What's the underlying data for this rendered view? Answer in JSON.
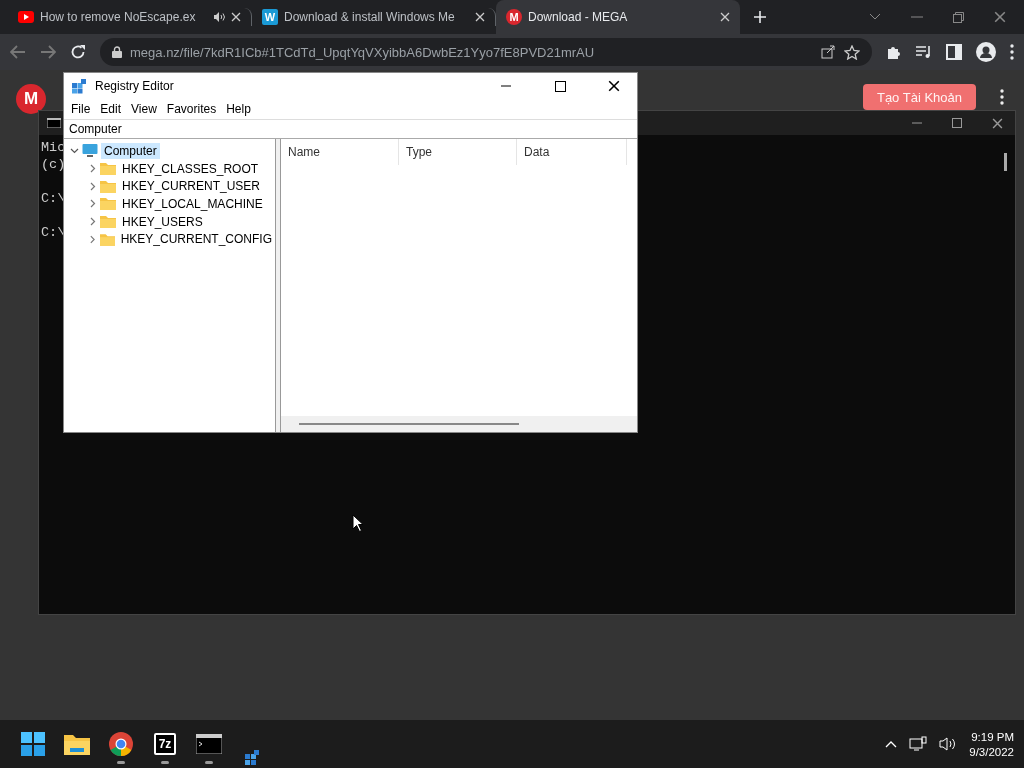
{
  "browser": {
    "tabs": [
      {
        "kind": "youtube",
        "title": "How to remove NoEscape.ex",
        "audio": true,
        "selected": false
      },
      {
        "kind": "letter",
        "favicon_text": "W",
        "title": "Download & install Windows Me",
        "audio": false,
        "selected": false
      },
      {
        "kind": "mega",
        "favicon_text": "M",
        "title": "Download - MEGA",
        "audio": false,
        "selected": true
      }
    ],
    "address": "mega.nz/file/7kdR1ICb#1TCdTd_UpqtYqVXyibbA6DwbEz1Yyo7fE8PVD21mrAU",
    "page": {
      "logo_text": "M",
      "signup_button": "Tạo Tài Khoản"
    }
  },
  "console": {
    "blocks": [
      [
        "Mic",
        "(c)"
      ],
      [
        "C:\\"
      ],
      [
        "C:\\"
      ]
    ]
  },
  "registry_editor": {
    "title": "Registry Editor",
    "menu": [
      "File",
      "Edit",
      "View",
      "Favorites",
      "Help"
    ],
    "address": "Computer",
    "tree": [
      {
        "label": "Computer",
        "kind": "computer",
        "expanded": true,
        "selected": true,
        "children": [
          {
            "label": "HKEY_CLASSES_ROOT",
            "kind": "folder",
            "expanded": false,
            "selected": false
          },
          {
            "label": "HKEY_CURRENT_USER",
            "kind": "folder",
            "expanded": false,
            "selected": false
          },
          {
            "label": "HKEY_LOCAL_MACHINE",
            "kind": "folder",
            "expanded": false,
            "selected": false
          },
          {
            "label": "HKEY_USERS",
            "kind": "folder",
            "expanded": false,
            "selected": false
          },
          {
            "label": "HKEY_CURRENT_CONFIG",
            "kind": "folder",
            "expanded": false,
            "selected": false
          }
        ]
      }
    ],
    "columns": [
      "Name",
      "Type",
      "Data"
    ]
  },
  "taskbar": {
    "apps": [
      {
        "kind": "start",
        "running": false
      },
      {
        "kind": "explorer",
        "running": false
      },
      {
        "kind": "chrome",
        "running": true
      },
      {
        "kind": "sevenzip",
        "label": "7z",
        "running": true
      },
      {
        "kind": "terminal",
        "running": true
      },
      {
        "kind": "regedit",
        "running": false
      }
    ],
    "time": "9:19 PM",
    "date": "9/3/2022"
  }
}
